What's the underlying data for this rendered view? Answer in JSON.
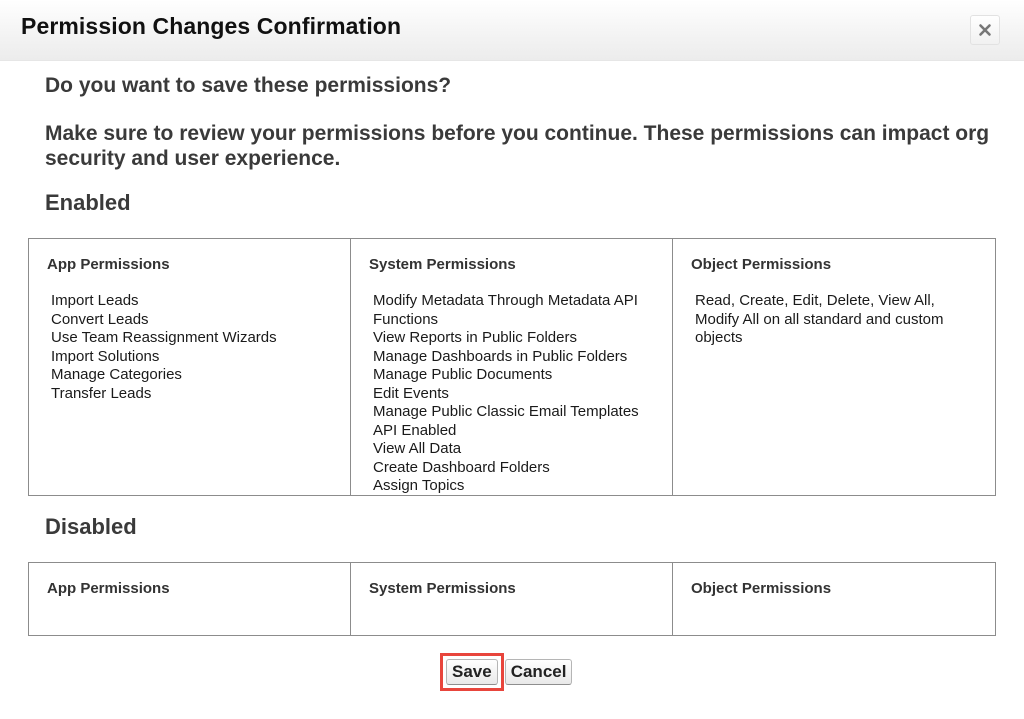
{
  "dialog": {
    "title": "Permission Changes Confirmation",
    "close_icon": "close-icon"
  },
  "content": {
    "question": "Do you want to save these permissions?",
    "warning": "Make sure to review your permissions before you continue. These permissions can impact org security and user experience."
  },
  "enabled": {
    "heading": "Enabled",
    "columns": {
      "app": {
        "header": "App Permissions",
        "items": [
          "Import Leads",
          "Convert Leads",
          "Use Team Reassignment Wizards",
          "Import Solutions",
          "Manage Categories",
          "Transfer Leads"
        ]
      },
      "system": {
        "header": "System Permissions",
        "items": [
          "Modify Metadata Through Metadata API Functions",
          "View Reports in Public Folders",
          "Manage Dashboards in Public Folders",
          "Manage Public Documents",
          "Edit Events",
          "Manage Public Classic Email Templates",
          "API Enabled",
          "View All Data",
          "Create Dashboard Folders",
          "Assign Topics"
        ]
      },
      "object": {
        "header": "Object Permissions",
        "text": "Read, Create, Edit, Delete, View All, Modify All on all standard and custom objects"
      }
    }
  },
  "disabled": {
    "heading": "Disabled",
    "columns": {
      "app": {
        "header": "App Permissions"
      },
      "system": {
        "header": "System Permissions"
      },
      "object": {
        "header": "Object Permissions"
      }
    }
  },
  "actions": {
    "save_label": "Save",
    "cancel_label": "Cancel"
  },
  "colors": {
    "highlight": "#e8453c",
    "table_border": "#8c8c8c"
  }
}
